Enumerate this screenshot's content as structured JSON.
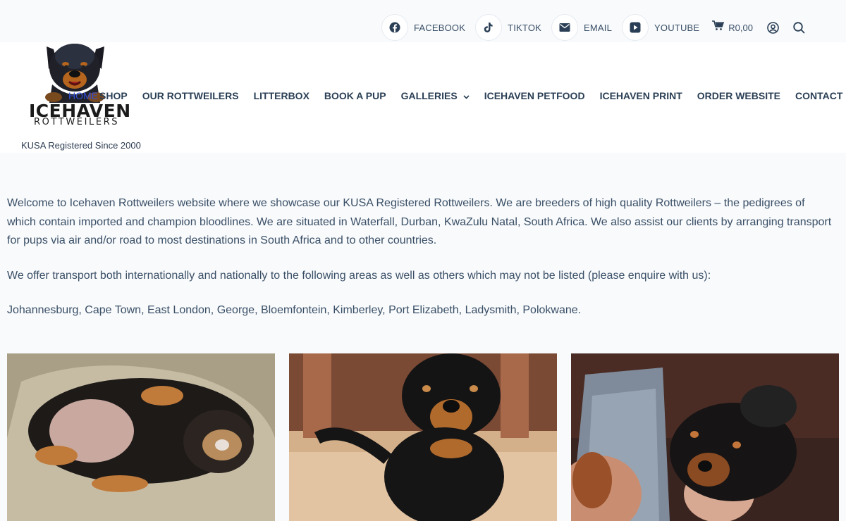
{
  "topbar": {
    "social": [
      {
        "label": "FACEBOOK",
        "icon": "facebook-icon"
      },
      {
        "label": "TIKTOK",
        "icon": "tiktok-icon"
      },
      {
        "label": "EMAIL",
        "icon": "email-icon"
      },
      {
        "label": "YOUTUBE",
        "icon": "youtube-icon"
      }
    ],
    "cart_total": "R0,00"
  },
  "header": {
    "logo_word": "ICEHAVEN",
    "logo_sub": "ROTTWEILERS",
    "tagline": "KUSA Registered Since 2000"
  },
  "nav": {
    "items": [
      {
        "label": "HOME"
      },
      {
        "label": "SHOP"
      },
      {
        "label": "OUR ROTTWEILERS"
      },
      {
        "label": "LITTERBOX"
      },
      {
        "label": "BOOK A PUP"
      },
      {
        "label": "GALLERIES"
      },
      {
        "label": "ICEHAVEN PETFOOD"
      },
      {
        "label": "ICEHAVEN PRINT"
      },
      {
        "label": "ORDER WEBSITE"
      },
      {
        "label": "CONTACT"
      }
    ]
  },
  "content": {
    "paragraphs": [
      "Welcome to Icehaven Rottweilers website where we showcase our KUSA Registered Rottweilers. We are breeders of high quality Rottweilers – the pedigrees of which contain imported and champion bloodlines. We are situated in Waterfall, Durban, KwaZulu Natal, South Africa. We also assist our clients by arranging transport for pups via air and/or road to most destinations in South Africa and to other countries.",
      "We offer transport both internationally and nationally to the following areas as well as others which may not be listed (please enquire with us):",
      "Johannesburg, Cape Town, East London, George, Bloemfontein, Kimberley, Port Elizabeth, Ladysmith, Polokwane."
    ]
  },
  "colors": {
    "accent": "#2f4cd6",
    "nav_text": "#2a3f55",
    "body_text": "#3a4f66",
    "background": "#f8fafc"
  }
}
